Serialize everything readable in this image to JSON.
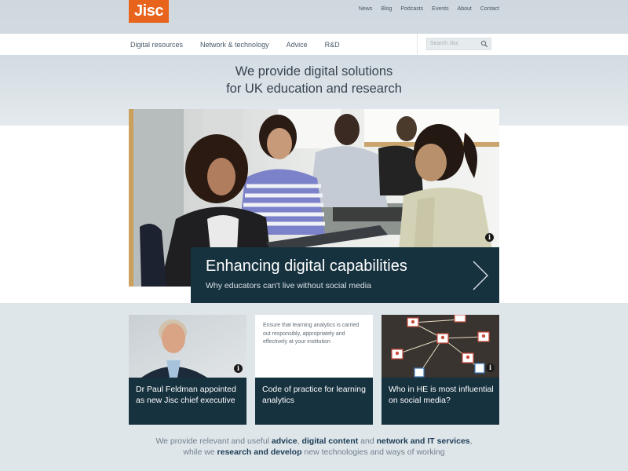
{
  "brand": {
    "logo": "Jisc",
    "accent": "#e8641c",
    "dark": "#17323f"
  },
  "util_nav": [
    "News",
    "Blog",
    "Podcasts",
    "Events",
    "About",
    "Contact"
  ],
  "main_nav": [
    "Digital resources",
    "Network & technology",
    "Advice",
    "R&D"
  ],
  "search": {
    "placeholder": "Search Jisc",
    "icon": "search-icon"
  },
  "tagline": {
    "line1": "We provide digital solutions",
    "line2": "for UK education and research"
  },
  "hero": {
    "title": "Enhancing digital capabilities",
    "subtitle": "Why educators can't live without social media",
    "info_icon": "i"
  },
  "cards": [
    {
      "label": "Dr Paul Feldman appointed as new Jisc chief executive",
      "info_icon": "i"
    },
    {
      "quote": "Ensure that learning analytics is carried out responsibly, appropriately and effectively at your institution",
      "label": "Code of practice for learning analytics"
    },
    {
      "label": "Who in HE is most influential on social media?",
      "info_icon": "i"
    }
  ],
  "strapline": {
    "p1": "We provide relevant and useful ",
    "k1": "advice",
    "p2": ", ",
    "k2": "digital content",
    "p3": " and ",
    "k3": "network and IT services",
    "p4": ",",
    "p5": "while we ",
    "k4": "research and develop",
    "p6": " new technologies and ways of working"
  }
}
